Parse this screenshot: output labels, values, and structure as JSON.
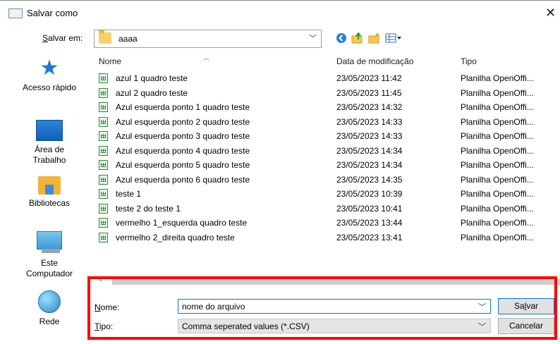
{
  "window": {
    "title": "Salvar como",
    "close_glyph": "✕",
    "close_icon": "close-icon"
  },
  "location": {
    "label_u": "S",
    "label_rest": "alvar em:",
    "value": "aaaa",
    "toolbar_icons": [
      "back-icon",
      "up-folder-icon",
      "new-folder-icon",
      "view-menu-icon"
    ]
  },
  "sidebar": {
    "items": [
      {
        "label": "Acesso rápido",
        "icon": "quick-access-star-icon"
      },
      {
        "label": "Área de Trabalho",
        "icon": "desktop-icon"
      },
      {
        "label": "Bibliotecas",
        "icon": "libraries-icon"
      },
      {
        "label": "Este Computador",
        "icon": "this-pc-icon"
      },
      {
        "label": "Rede",
        "icon": "network-icon"
      }
    ]
  },
  "filelist": {
    "columns": [
      "Nome",
      "Data de modificação",
      "Tipo"
    ],
    "rows": [
      {
        "name": "azul 1 quadro teste",
        "date": "23/05/2023 11:42",
        "type": "Planilha OpenOffi..."
      },
      {
        "name": "azul 2 quadro teste",
        "date": "23/05/2023 11:45",
        "type": "Planilha OpenOffi..."
      },
      {
        "name": "Azul esquerda ponto 1 quadro teste",
        "date": "23/05/2023 14:32",
        "type": "Planilha OpenOffi..."
      },
      {
        "name": "Azul esquerda ponto 2 quadro teste",
        "date": "23/05/2023 14:33",
        "type": "Planilha OpenOffi..."
      },
      {
        "name": "Azul esquerda ponto 3 quadro teste",
        "date": "23/05/2023 14:33",
        "type": "Planilha OpenOffi..."
      },
      {
        "name": "Azul esquerda ponto 4 quadro teste",
        "date": "23/05/2023 14:34",
        "type": "Planilha OpenOffi..."
      },
      {
        "name": "Azul esquerda ponto 5 quadro teste",
        "date": "23/05/2023 14:34",
        "type": "Planilha OpenOffi..."
      },
      {
        "name": "Azul esquerda ponto 6 quadro teste",
        "date": "23/05/2023 14:35",
        "type": "Planilha OpenOffi..."
      },
      {
        "name": "teste 1",
        "date": "23/05/2023 10:39",
        "type": "Planilha OpenOffi..."
      },
      {
        "name": "teste 2 do teste 1",
        "date": "23/05/2023 10:41",
        "type": "Planilha OpenOffi..."
      },
      {
        "name": "vermelho 1_esquerda quadro teste",
        "date": "23/05/2023 13:44",
        "type": "Planilha OpenOffi..."
      },
      {
        "name": "vermelho 2_direita quadro teste",
        "date": "23/05/2023 13:41",
        "type": "Planilha OpenOffi..."
      }
    ]
  },
  "save": {
    "name_label_u": "N",
    "name_label_rest": "ome:",
    "name_value": "nome do arquivo",
    "type_label_u": "T",
    "type_label_rest": "ipo:",
    "type_value": "Comma seperated values (*.CSV)",
    "save_pre": "Sa",
    "save_u": "l",
    "save_post": "var",
    "cancel_label": "Cancelar",
    "highlight_color": "#ff0000"
  }
}
